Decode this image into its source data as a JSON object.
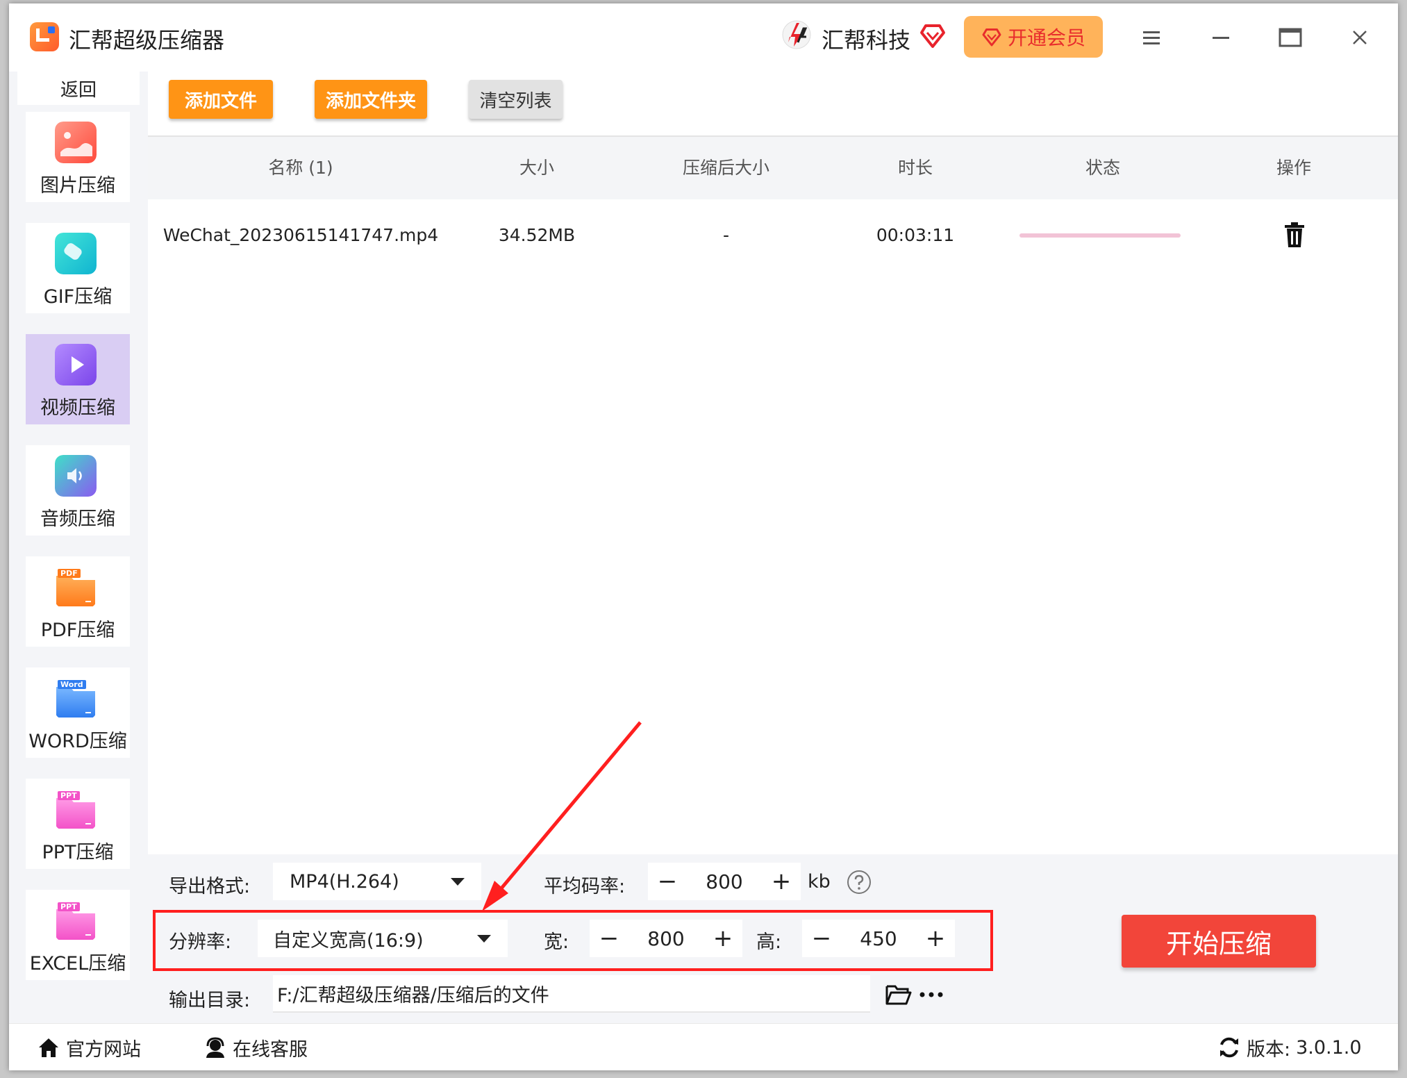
{
  "window": {
    "app_title": "汇帮超级压缩器",
    "brand_name": "汇帮科技",
    "vip_label": "开通会员"
  },
  "sidebar": {
    "back_label": "返回",
    "items": [
      {
        "label": "图片压缩",
        "icon": "image-icon",
        "color": "#ff6a5a",
        "active": false
      },
      {
        "label": "GIF压缩",
        "icon": "gif-icon",
        "color": "#1ec8d8",
        "active": false
      },
      {
        "label": "视频压缩",
        "icon": "video-play-icon",
        "color": "#8c5cf0",
        "active": true
      },
      {
        "label": "音频压缩",
        "icon": "audio-icon",
        "color": "#5aa0f5",
        "active": false
      },
      {
        "label": "PDF压缩",
        "icon": "pdf-folder-icon",
        "color": "#ff8a2a",
        "active": false
      },
      {
        "label": "WORD压缩",
        "icon": "word-folder-icon",
        "color": "#3b8cf2",
        "active": false
      },
      {
        "label": "PPT压缩",
        "icon": "ppt-folder-icon",
        "color": "#f66bd0",
        "active": false
      },
      {
        "label": "EXCEL压缩",
        "icon": "excel-folder-icon",
        "color": "#f66bd0",
        "active": false
      }
    ],
    "badges": {
      "pdf": "PDF",
      "word": "Word",
      "ppt": "PPT",
      "excel": "PPT"
    }
  },
  "toolbar": {
    "add_file": "添加文件",
    "add_folder": "添加文件夹",
    "clear_list": "清空列表"
  },
  "table": {
    "headers": {
      "name": "名称 (1)",
      "size": "大小",
      "compressed_size": "压缩后大小",
      "duration": "时长",
      "status": "状态",
      "action": "操作"
    },
    "rows": [
      {
        "name": "WeChat_20230615141747.mp4",
        "size": "34.52MB",
        "compressed_size": "-",
        "duration": "00:03:11"
      }
    ]
  },
  "settings": {
    "format_label": "导出格式:",
    "format_value": "MP4(H.264)",
    "bitrate_label": "平均码率:",
    "bitrate_value": "800",
    "bitrate_unit": "kb",
    "resolution_label": "分辨率:",
    "resolution_value": "自定义宽高(16:9)",
    "width_label": "宽:",
    "width_value": "800",
    "height_label": "高:",
    "height_value": "450",
    "output_label": "输出目录:",
    "output_value": "F:/汇帮超级压缩器/压缩后的文件",
    "start_label": "开始压缩"
  },
  "footer": {
    "website": "官方网站",
    "support": "在线客服",
    "version_label": "版本:",
    "version_value": "3.0.1.0"
  },
  "colors": {
    "accent_orange": "#ff9415",
    "start_red": "#f2453a",
    "highlight_red": "#ff1f1f",
    "sidebar_active": "#d9cdf3"
  }
}
